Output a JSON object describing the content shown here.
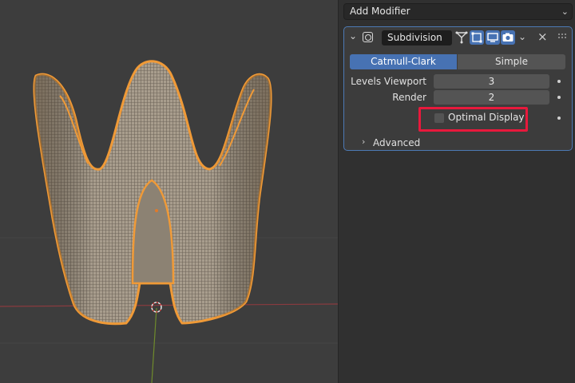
{
  "viewport": {
    "object_outline_color": "#f09a37",
    "mesh_fill_color": "#9c9284",
    "x_axis_color": "#8a3b3f",
    "y_axis_color": "#6f8b2c"
  },
  "properties": {
    "add_modifier_label": "Add Modifier",
    "add_modifier_icon": "chevron-down-icon",
    "modifier": {
      "name": "Subdivision",
      "type_icon": "subdivision-modifier-icon",
      "accent_color": "#4772b3",
      "algorithm_options": [
        "Catmull-Clark",
        "Simple"
      ],
      "selected_algorithm": "Catmull-Clark",
      "levels_viewport_label": "Levels Viewport",
      "levels_viewport_value": "3",
      "render_label": "Render",
      "render_value": "2",
      "optimal_display_label": "Optimal Display",
      "optimal_display_checked": false,
      "advanced_label": "Advanced"
    },
    "highlight_color": "#e8193c"
  }
}
